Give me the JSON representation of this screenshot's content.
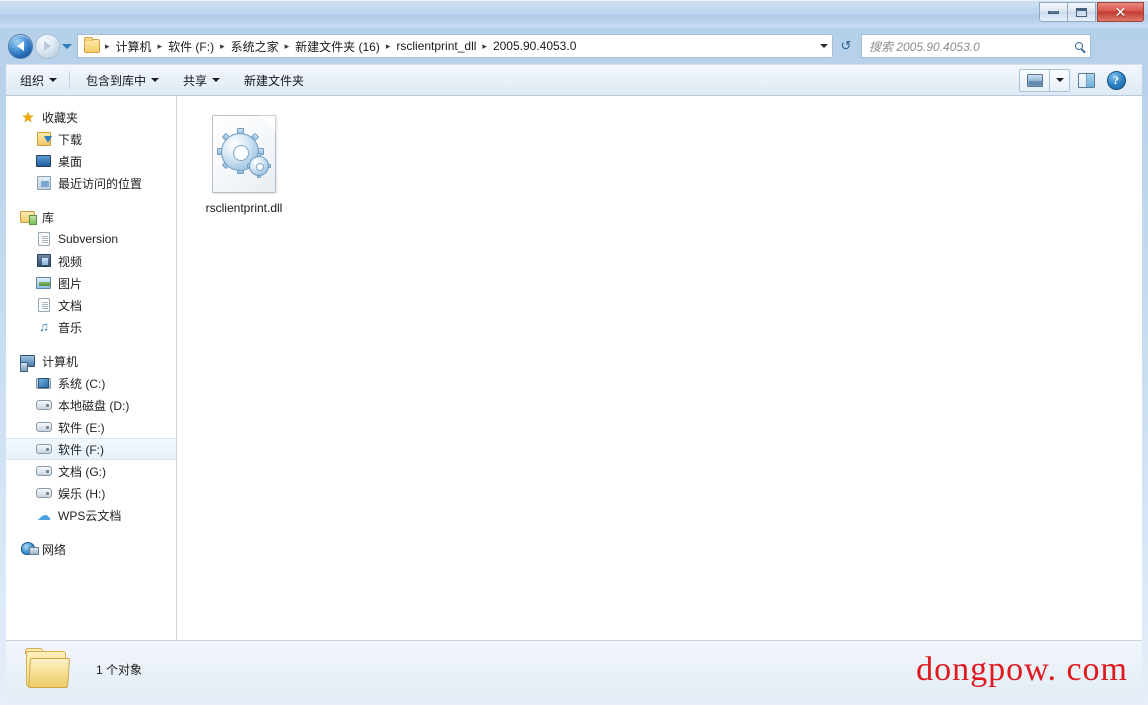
{
  "window": {
    "buttons": {
      "minimize": "minimize",
      "maximize": "maximize",
      "close": "✕"
    }
  },
  "address_bar": {
    "back_label": "后退",
    "forward_label": "前进",
    "history_label": "最近位置",
    "breadcrumbs": [
      {
        "label": "计算机"
      },
      {
        "label": "软件 (F:)"
      },
      {
        "label": "系统之家"
      },
      {
        "label": "新建文件夹 (16)"
      },
      {
        "label": "rsclientprint_dll"
      },
      {
        "label": "2005.90.4053.0"
      }
    ],
    "separator": "▸",
    "refresh_glyph": "↺",
    "search_placeholder": "搜索 2005.90.4053.0",
    "search_value": ""
  },
  "toolbar": {
    "items": [
      {
        "label": "组织",
        "has_caret": true
      },
      {
        "label": "包含到库中",
        "has_caret": true
      },
      {
        "label": "共享",
        "has_caret": true
      },
      {
        "label": "新建文件夹",
        "has_caret": false
      }
    ],
    "view_button_label": "更改您的视图",
    "preview_button_label": "显示预览窗格",
    "help_button_label": "?"
  },
  "sidebar": {
    "groups": [
      {
        "header": {
          "label": "收藏夹",
          "icon": "star-icon"
        },
        "items": [
          {
            "label": "下载",
            "icon": "download-icon",
            "selected": false
          },
          {
            "label": "桌面",
            "icon": "desktop-icon",
            "selected": false
          },
          {
            "label": "最近访问的位置",
            "icon": "recent-places-icon",
            "selected": false
          }
        ]
      },
      {
        "header": {
          "label": "库",
          "icon": "library-icon"
        },
        "items": [
          {
            "label": "Subversion",
            "icon": "document-icon",
            "selected": false
          },
          {
            "label": "视频",
            "icon": "video-icon",
            "selected": false
          },
          {
            "label": "图片",
            "icon": "pictures-icon",
            "selected": false
          },
          {
            "label": "文档",
            "icon": "document-icon",
            "selected": false
          },
          {
            "label": "音乐",
            "icon": "music-icon",
            "selected": false
          }
        ]
      },
      {
        "header": {
          "label": "计算机",
          "icon": "computer-icon"
        },
        "items": [
          {
            "label": "系统 (C:)",
            "icon": "system-drive-icon",
            "selected": false
          },
          {
            "label": "本地磁盘 (D:)",
            "icon": "drive-icon",
            "selected": false
          },
          {
            "label": "软件 (E:)",
            "icon": "drive-icon",
            "selected": false
          },
          {
            "label": "软件 (F:)",
            "icon": "drive-icon",
            "selected": true
          },
          {
            "label": "文档 (G:)",
            "icon": "drive-icon",
            "selected": false
          },
          {
            "label": "娱乐 (H:)",
            "icon": "drive-icon",
            "selected": false
          },
          {
            "label": "WPS云文档",
            "icon": "cloud-icon",
            "selected": false
          }
        ]
      },
      {
        "header": {
          "label": "网络",
          "icon": "network-icon"
        },
        "items": []
      }
    ]
  },
  "file_pane": {
    "files": [
      {
        "name": "rsclientprint.dll",
        "icon": "dll-file-icon",
        "selected": false
      }
    ]
  },
  "status_bar": {
    "folder_icon": "folder-icon",
    "text": "1 个对象"
  },
  "watermark": {
    "text": "dongpow. com",
    "color": "#e0191f"
  },
  "colors": {
    "title_glass": "#bcd4ec",
    "close_red": "#c03d30",
    "selection_blue": "#e6f1fa",
    "accent": "#2a7fc4"
  }
}
